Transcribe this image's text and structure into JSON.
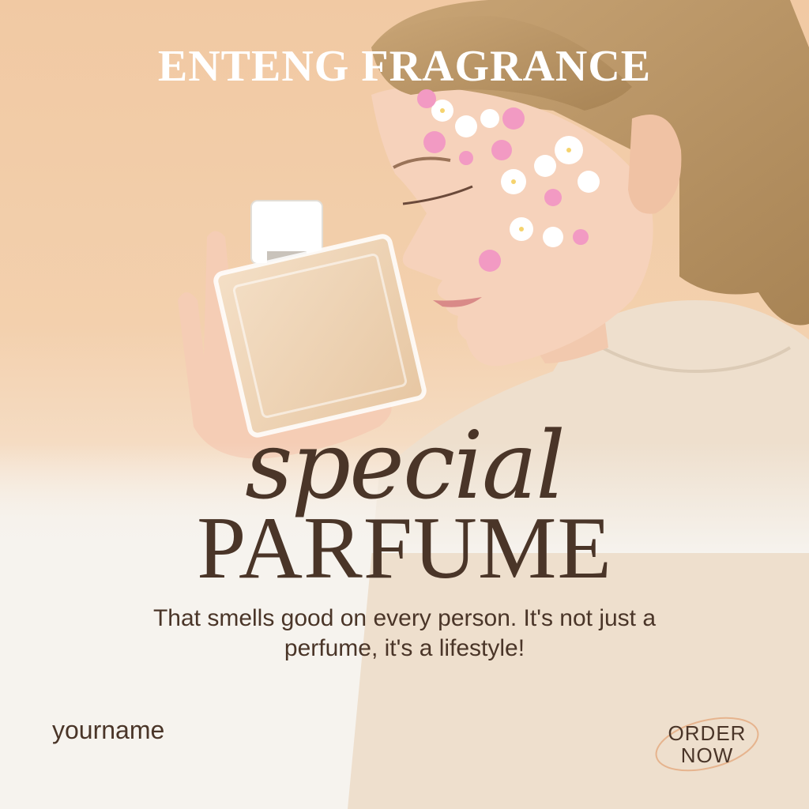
{
  "brand": "ENTENG FRAGRANCE",
  "headline_script": "special",
  "headline_main": "PARFUME",
  "description": "That smells good on every person. It's not just a perfume, it's a lifestyle!",
  "footer": {
    "name": "yourname",
    "cta_line1": "ORDER",
    "cta_line2": "NOW"
  },
  "colors": {
    "background_top": "#f1c9a3",
    "background_bottom": "#f6f3ee",
    "text_brown": "#4a3528",
    "cta_ring": "#e6b48e"
  }
}
